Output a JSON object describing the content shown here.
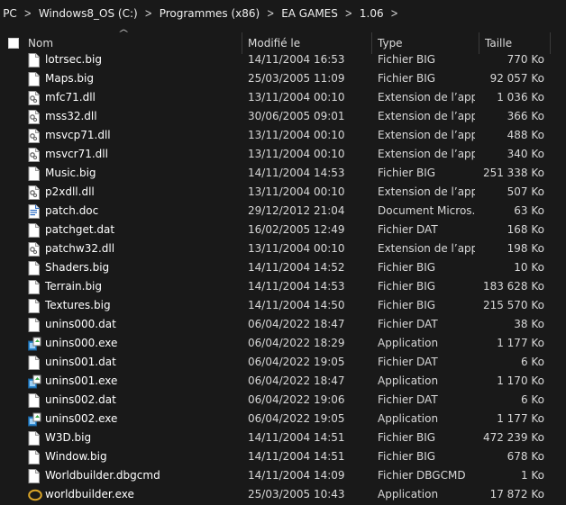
{
  "breadcrumb": [
    "e PC",
    "Windows8_OS (C:)",
    "Programmes (x86)",
    "EA GAMES",
    "1.06"
  ],
  "columns": {
    "name": "Nom",
    "modified": "Modifié le",
    "type": "Type",
    "size": "Taille"
  },
  "files": [
    {
      "name": "lotrsec.big",
      "date": "14/11/2004 16:53",
      "type": "Fichier BIG",
      "size": "770 Ko",
      "icon": "file-icon"
    },
    {
      "name": "Maps.big",
      "date": "25/03/2005 11:09",
      "type": "Fichier BIG",
      "size": "92 057 Ko",
      "icon": "file-icon"
    },
    {
      "name": "mfc71.dll",
      "date": "13/11/2004 00:10",
      "type": "Extension de l’app...",
      "size": "1 036 Ko",
      "icon": "dll-icon"
    },
    {
      "name": "mss32.dll",
      "date": "30/06/2005 09:01",
      "type": "Extension de l’app...",
      "size": "366 Ko",
      "icon": "dll-icon"
    },
    {
      "name": "msvcp71.dll",
      "date": "13/11/2004 00:10",
      "type": "Extension de l’app...",
      "size": "488 Ko",
      "icon": "dll-icon"
    },
    {
      "name": "msvcr71.dll",
      "date": "13/11/2004 00:10",
      "type": "Extension de l’app...",
      "size": "340 Ko",
      "icon": "dll-icon"
    },
    {
      "name": "Music.big",
      "date": "14/11/2004 14:53",
      "type": "Fichier BIG",
      "size": "251 338 Ko",
      "icon": "file-icon"
    },
    {
      "name": "p2xdll.dll",
      "date": "13/11/2004 00:10",
      "type": "Extension de l’app...",
      "size": "507 Ko",
      "icon": "dll-icon"
    },
    {
      "name": "patch.doc",
      "date": "29/12/2012 21:04",
      "type": "Document Micros...",
      "size": "63 Ko",
      "icon": "doc-icon"
    },
    {
      "name": "patchget.dat",
      "date": "16/02/2005 12:49",
      "type": "Fichier DAT",
      "size": "168 Ko",
      "icon": "file-icon"
    },
    {
      "name": "patchw32.dll",
      "date": "13/11/2004 00:10",
      "type": "Extension de l’app...",
      "size": "198 Ko",
      "icon": "dll-icon"
    },
    {
      "name": "Shaders.big",
      "date": "14/11/2004 14:52",
      "type": "Fichier BIG",
      "size": "10 Ko",
      "icon": "file-icon"
    },
    {
      "name": "Terrain.big",
      "date": "14/11/2004 14:53",
      "type": "Fichier BIG",
      "size": "183 628 Ko",
      "icon": "file-icon"
    },
    {
      "name": "Textures.big",
      "date": "14/11/2004 14:50",
      "type": "Fichier BIG",
      "size": "215 570 Ko",
      "icon": "file-icon"
    },
    {
      "name": "unins000.dat",
      "date": "06/04/2022 18:47",
      "type": "Fichier DAT",
      "size": "38 Ko",
      "icon": "file-icon"
    },
    {
      "name": "unins000.exe",
      "date": "06/04/2022 18:29",
      "type": "Application",
      "size": "1 177 Ko",
      "icon": "installer-icon"
    },
    {
      "name": "unins001.dat",
      "date": "06/04/2022 19:05",
      "type": "Fichier DAT",
      "size": "6 Ko",
      "icon": "file-icon"
    },
    {
      "name": "unins001.exe",
      "date": "06/04/2022 18:47",
      "type": "Application",
      "size": "1 170 Ko",
      "icon": "installer-icon"
    },
    {
      "name": "unins002.dat",
      "date": "06/04/2022 19:06",
      "type": "Fichier DAT",
      "size": "6 Ko",
      "icon": "file-icon"
    },
    {
      "name": "unins002.exe",
      "date": "06/04/2022 19:05",
      "type": "Application",
      "size": "1 177 Ko",
      "icon": "installer-icon"
    },
    {
      "name": "W3D.big",
      "date": "14/11/2004 14:51",
      "type": "Fichier BIG",
      "size": "472 239 Ko",
      "icon": "file-icon"
    },
    {
      "name": "Window.big",
      "date": "14/11/2004 14:51",
      "type": "Fichier BIG",
      "size": "678 Ko",
      "icon": "file-icon"
    },
    {
      "name": "Worldbuilder.dbgcmd",
      "date": "14/11/2004 14:09",
      "type": "Fichier DBGCMD",
      "size": "1 Ko",
      "icon": "file-icon"
    },
    {
      "name": "worldbuilder.exe",
      "date": "25/03/2005 10:43",
      "type": "Application",
      "size": "17 872 Ko",
      "icon": "ring-app-icon"
    }
  ]
}
